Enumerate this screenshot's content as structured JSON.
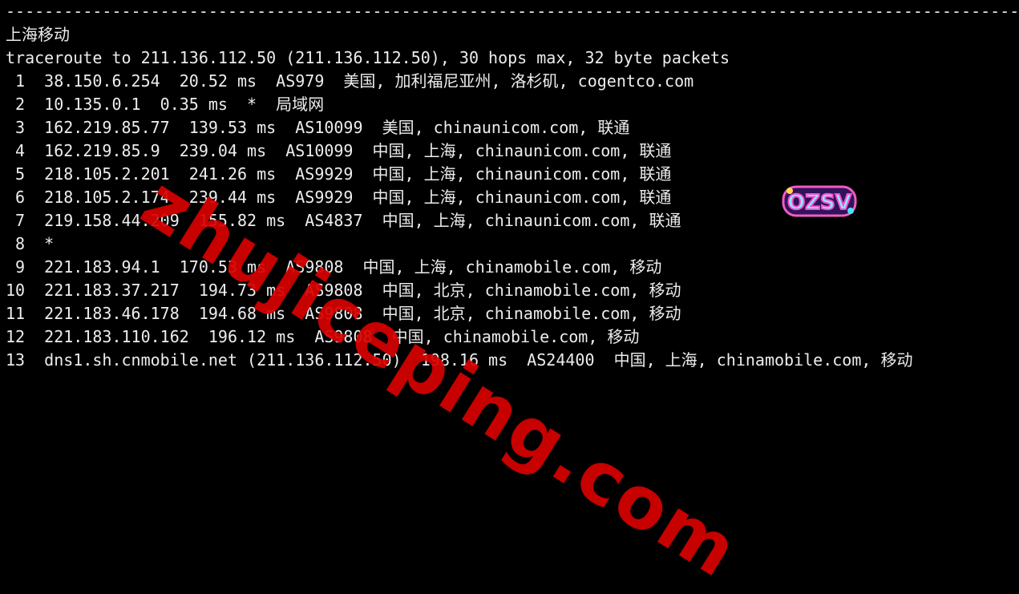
{
  "terminal": {
    "separator": "----------------------------------------------------------------------------------------------------------------------------------",
    "title": "上海移动",
    "header": "traceroute to 211.136.112.50 (211.136.112.50), 30 hops max, 32 byte packets",
    "hops": [
      " 1  38.150.6.254  20.52 ms  AS979  美国, 加利福尼亚州, 洛杉矶, cogentco.com",
      " 2  10.135.0.1  0.35 ms  *  局域网",
      " 3  162.219.85.77  139.53 ms  AS10099  美国, chinaunicom.com, 联通",
      " 4  162.219.85.9  239.04 ms  AS10099  中国, 上海, chinaunicom.com, 联通",
      " 5  218.105.2.201  241.26 ms  AS9929  中国, 上海, chinaunicom.com, 联通",
      " 6  218.105.2.174  239.44 ms  AS9929  中国, 上海, chinaunicom.com, 联通",
      " 7  219.158.44.209  155.82 ms  AS4837  中国, 上海, chinaunicom.com, 联通",
      " 8  *",
      " 9  221.183.94.1  170.53 ms  AS9808  中国, 上海, chinamobile.com, 移动",
      "10  221.183.37.217  194.73 ms  AS9808  中国, 北京, chinamobile.com, 移动",
      "11  221.183.46.178  194.68 ms  AS9808  中国, 北京, chinamobile.com, 移动",
      "12  221.183.110.162  196.12 ms  AS9808  中国, chinamobile.com, 移动",
      "13  dns1.sh.cnmobile.net (211.136.112.50)  198.16 ms  AS24400  中国, 上海, chinamobile.com, 移动"
    ]
  },
  "watermark": {
    "text": "zhujiceping.com",
    "color": "#d80000"
  },
  "logo": {
    "text": "OZSV",
    "icon": "ozsv-logo-icon"
  },
  "colors": {
    "background": "#000000",
    "text": "#ededed"
  }
}
